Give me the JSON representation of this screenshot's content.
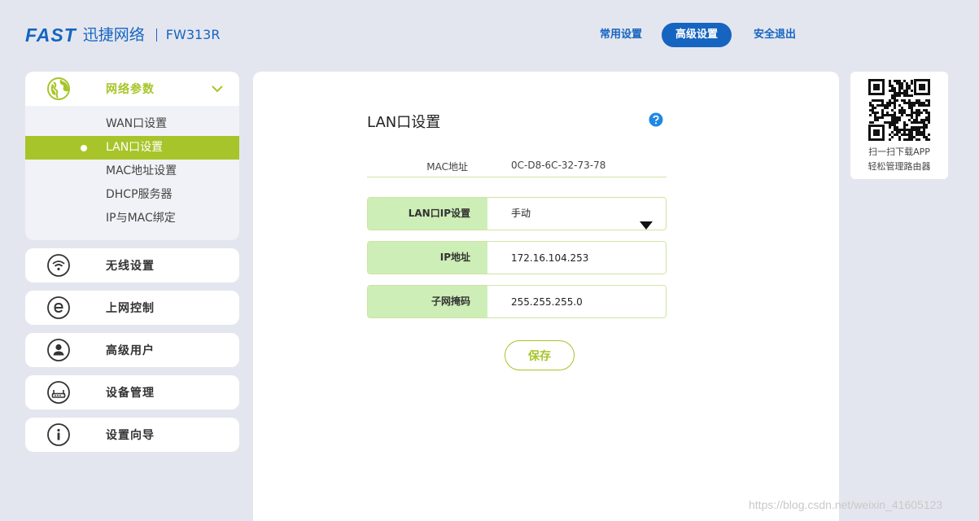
{
  "brand": {
    "logo_text": "FAST",
    "name_cn": "迅捷网络",
    "model": "FW313R"
  },
  "topnav": {
    "items": [
      {
        "label": "常用设置",
        "active": false
      },
      {
        "label": "高级设置",
        "active": true
      },
      {
        "label": "安全退出",
        "active": false
      }
    ]
  },
  "sidebar": {
    "network": {
      "label": "网络参数",
      "icon": "globe-icon",
      "expanded": true,
      "sub_items": [
        {
          "label": "WAN口设置",
          "active": false
        },
        {
          "label": "LAN口设置",
          "active": true
        },
        {
          "label": "MAC地址设置",
          "active": false
        },
        {
          "label": "DHCP服务器",
          "active": false
        },
        {
          "label": "IP与MAC绑定",
          "active": false
        }
      ]
    },
    "menus": [
      {
        "label": "无线设置",
        "icon": "wifi-icon"
      },
      {
        "label": "上网控制",
        "icon": "browser-e-icon"
      },
      {
        "label": "高级用户",
        "icon": "user-icon"
      },
      {
        "label": "设备管理",
        "icon": "router-icon"
      },
      {
        "label": "设置向导",
        "icon": "info-icon"
      }
    ]
  },
  "main": {
    "title": "LAN口设置",
    "mac": {
      "label": "MAC地址",
      "value": "0C-D8-6C-32-73-78"
    },
    "lan_ip_mode": {
      "label": "LAN口IP设置",
      "value": "手动"
    },
    "ip": {
      "label": "IP地址",
      "value": "172.16.104.253"
    },
    "mask": {
      "label": "子网掩码",
      "value": "255.255.255.0"
    },
    "save_label": "保存"
  },
  "qr": {
    "line1": "扫一扫下载APP",
    "line2": "轻松管理路由器"
  },
  "watermark": "https://blog.csdn.net/weixin_41605123",
  "colors": {
    "brand_blue": "#1565c0",
    "accent_green": "#a7c52a",
    "label_green": "#cdeeb6"
  }
}
